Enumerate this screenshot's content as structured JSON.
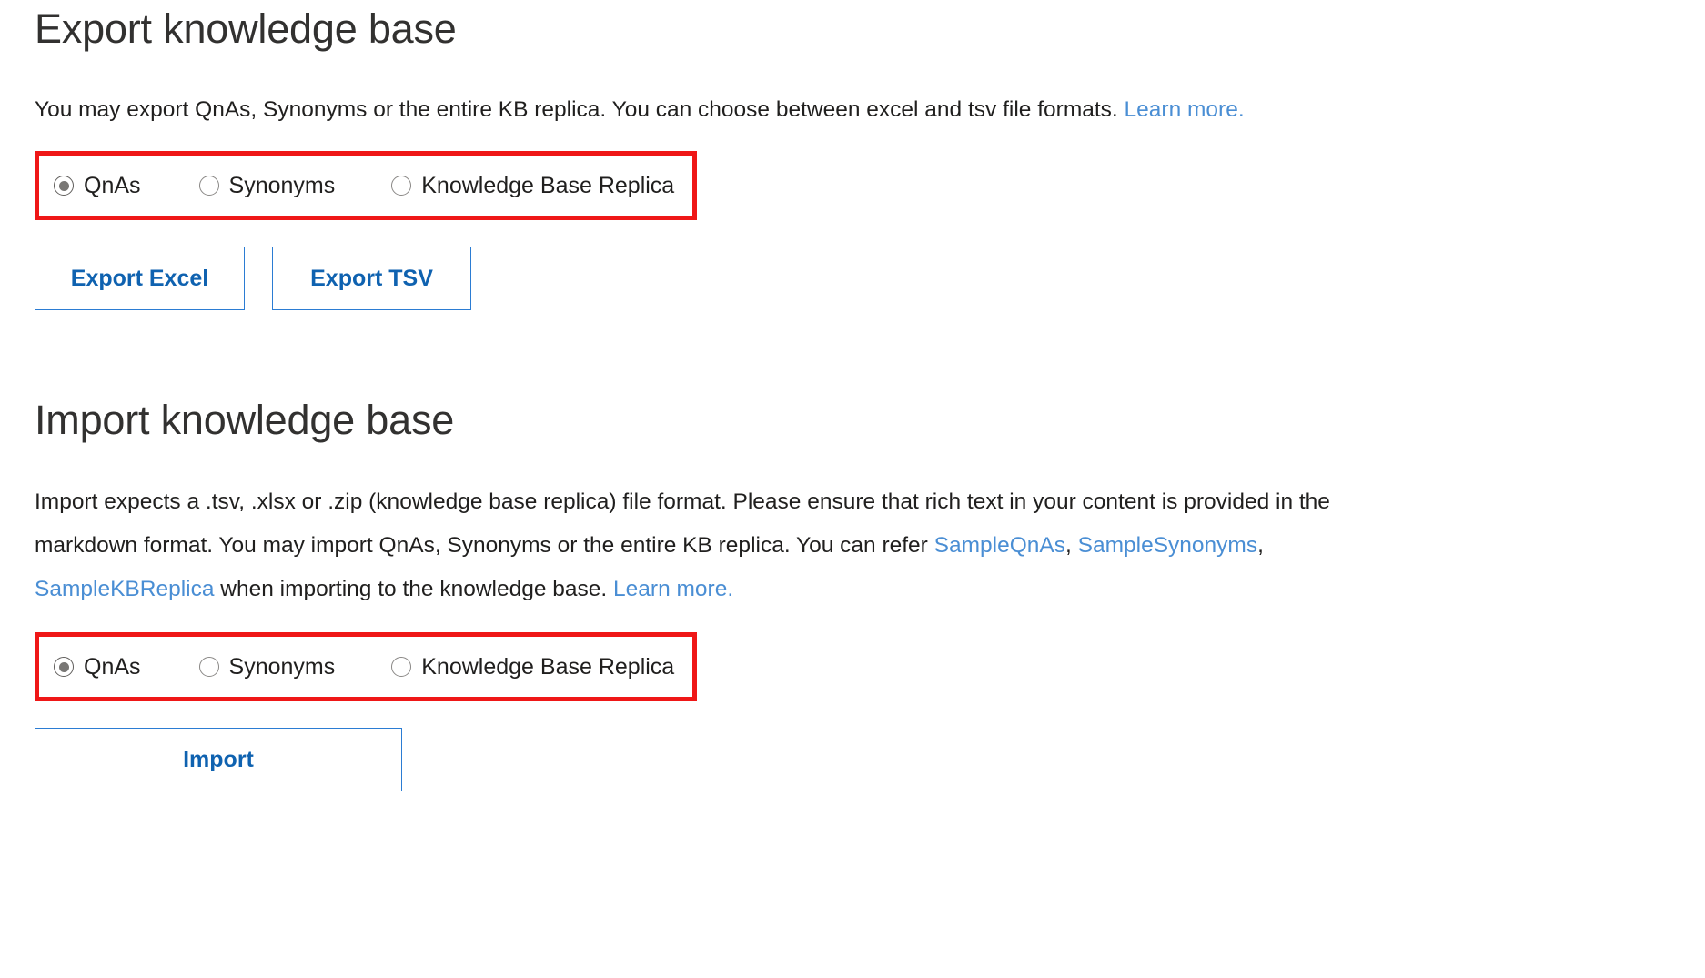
{
  "export": {
    "heading": "Export knowledge base",
    "description_before_link": "You may export QnAs, Synonyms or the entire KB replica. You can choose between excel and tsv file formats. ",
    "learn_more_label": "Learn more.",
    "radio_group": {
      "selected": "QnAs",
      "options": [
        {
          "label": "QnAs",
          "checked": true
        },
        {
          "label": "Synonyms",
          "checked": false
        },
        {
          "label": "Knowledge Base Replica",
          "checked": false
        }
      ]
    },
    "buttons": {
      "export_excel_label": "Export Excel",
      "export_tsv_label": "Export TSV"
    }
  },
  "import": {
    "heading": "Import knowledge base",
    "desc_part1": "Import expects a .tsv, .xlsx or .zip (knowledge base replica) file format. Please ensure that rich text in your content is provided in the markdown format. You may import QnAs, Synonyms or the entire KB replica. You can refer ",
    "link_sample_qnas": "SampleQnAs",
    "desc_sep1": ", ",
    "link_sample_synonyms": "SampleSynonyms",
    "desc_sep2": ", ",
    "link_sample_kbreplica": "SampleKBReplica",
    "desc_part2": " when importing to the knowledge base. ",
    "learn_more_label": "Learn more.",
    "radio_group": {
      "selected": "QnAs",
      "options": [
        {
          "label": "QnAs",
          "checked": true
        },
        {
          "label": "Synonyms",
          "checked": false
        },
        {
          "label": "Knowledge Base Replica",
          "checked": false
        }
      ]
    },
    "buttons": {
      "import_label": "Import"
    }
  },
  "colors": {
    "highlight_border": "#ef1717",
    "link": "#4a8ed4",
    "button_border": "#2b7cd3",
    "button_text": "#0f62b0",
    "heading_text": "#323130",
    "body_text": "#201f1e"
  }
}
